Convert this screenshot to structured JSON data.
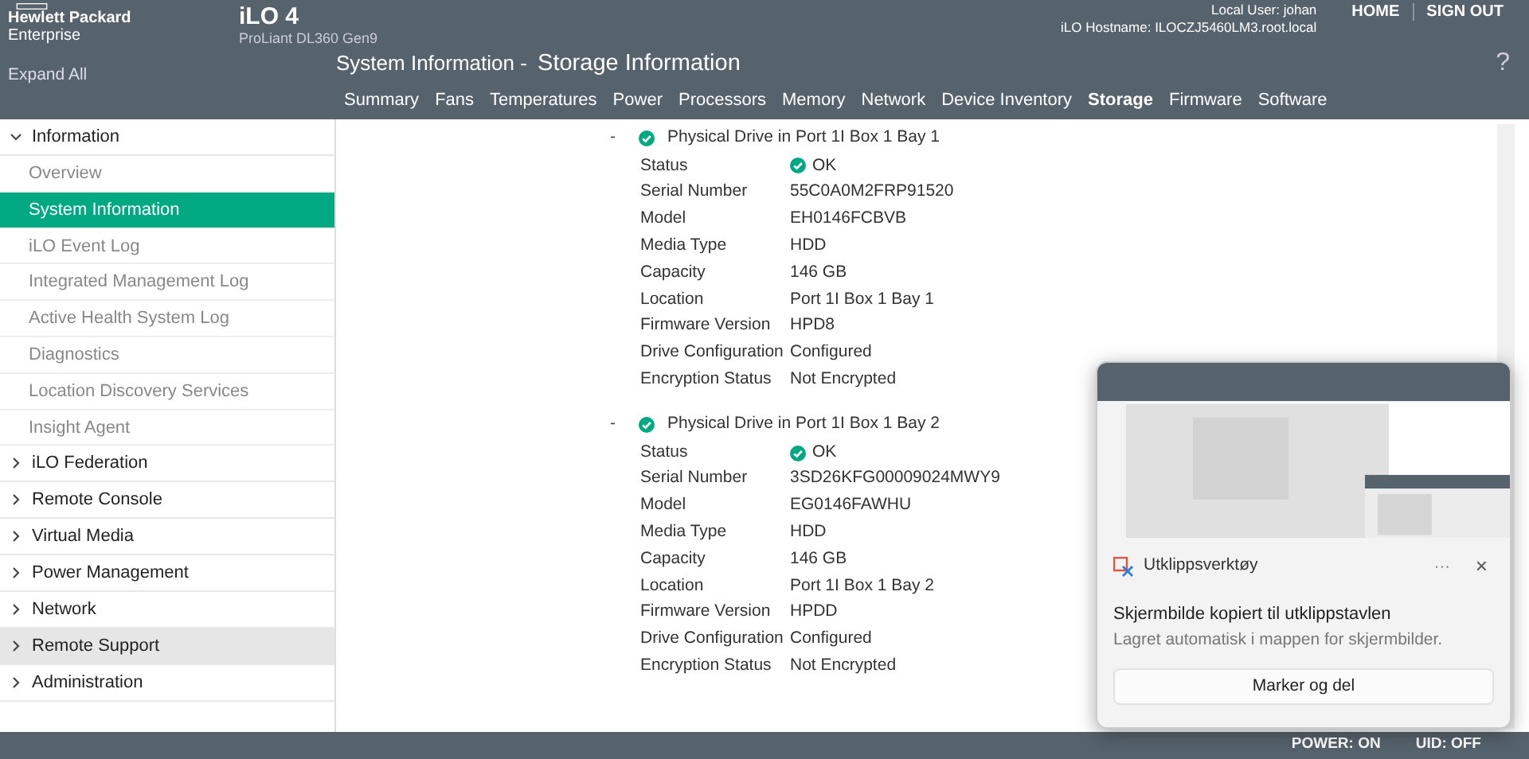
{
  "header": {
    "brand_line_1": "Hewlett Packard",
    "brand_line_2": "Enterprise",
    "product": "iLO 4",
    "server_model": "ProLiant DL360 Gen9",
    "local_user": "Local User: johan",
    "hostname": "iLO Hostname: ILOCZJ5460LM3.root.local",
    "links": [
      "HOME",
      "SIGN OUT"
    ],
    "help": "?"
  },
  "sidebar": {
    "expand_all": "Expand All",
    "items": [
      {
        "label": "Information",
        "expanded": true,
        "hovered": false,
        "children": [
          {
            "label": "Overview",
            "selected": false
          },
          {
            "label": "System Information",
            "selected": true
          },
          {
            "label": "iLO Event Log",
            "selected": false
          },
          {
            "label": "Integrated Management Log",
            "selected": false
          },
          {
            "label": "Active Health System Log",
            "selected": false
          },
          {
            "label": "Diagnostics",
            "selected": false
          },
          {
            "label": "Location Discovery Services",
            "selected": false
          },
          {
            "label": "Insight Agent",
            "selected": false
          }
        ]
      },
      {
        "label": "iLO Federation",
        "expanded": false,
        "hovered": false
      },
      {
        "label": "Remote Console",
        "expanded": false,
        "hovered": false
      },
      {
        "label": "Virtual Media",
        "expanded": false,
        "hovered": false
      },
      {
        "label": "Power Management",
        "expanded": false,
        "hovered": false
      },
      {
        "label": "Network",
        "expanded": false,
        "hovered": false
      },
      {
        "label": "Remote Support",
        "expanded": false,
        "hovered": true
      },
      {
        "label": "Administration",
        "expanded": false,
        "hovered": false
      }
    ]
  },
  "page": {
    "title_prefix": "System Information - ",
    "title": "Storage Information"
  },
  "tabs": [
    {
      "label": "Summary",
      "selected": false
    },
    {
      "label": "Fans",
      "selected": false
    },
    {
      "label": "Temperatures",
      "selected": false
    },
    {
      "label": "Power",
      "selected": false
    },
    {
      "label": "Processors",
      "selected": false
    },
    {
      "label": "Memory",
      "selected": false
    },
    {
      "label": "Network",
      "selected": false
    },
    {
      "label": "Device Inventory",
      "selected": false
    },
    {
      "label": "Storage",
      "selected": true
    },
    {
      "label": "Firmware",
      "selected": false
    },
    {
      "label": "Software",
      "selected": false
    }
  ],
  "drives": [
    {
      "toggle": "-",
      "title": "Physical Drive in Port 1I Box 1 Bay 1",
      "expanded": true,
      "rows": [
        {
          "label": "Status",
          "value": "OK",
          "kind": "status"
        },
        {
          "label": "Serial Number",
          "value": "55C0A0M2FRP91520",
          "kind": "text"
        },
        {
          "label": "Model",
          "value": "EH0146FCBVB",
          "kind": "text"
        },
        {
          "label": "Media Type",
          "value": "HDD",
          "kind": "text"
        },
        {
          "label": "Capacity",
          "value": "146 GB",
          "kind": "text"
        },
        {
          "label": "Location",
          "value": "Port 1I Box 1 Bay 1",
          "kind": "text"
        },
        {
          "label": "Firmware Version",
          "value": "HPD8",
          "kind": "text"
        },
        {
          "label": "Drive Configuration",
          "value": "Configured",
          "kind": "text"
        },
        {
          "label": "Encryption Status",
          "value": "Not Encrypted",
          "kind": "text"
        }
      ]
    },
    {
      "toggle": "-",
      "title": "Physical Drive in Port 1I Box 1 Bay 2",
      "expanded": true,
      "rows": [
        {
          "label": "Status",
          "value": "OK",
          "kind": "status"
        },
        {
          "label": "Serial Number",
          "value": "3SD26KFG00009024MWY9",
          "kind": "text"
        },
        {
          "label": "Model",
          "value": "EG0146FAWHU",
          "kind": "text"
        },
        {
          "label": "Media Type",
          "value": "HDD",
          "kind": "text"
        },
        {
          "label": "Capacity",
          "value": "146 GB",
          "kind": "text"
        },
        {
          "label": "Location",
          "value": "Port 1I Box 1 Bay 2",
          "kind": "text"
        },
        {
          "label": "Firmware Version",
          "value": "HPDD",
          "kind": "text"
        },
        {
          "label": "Drive Configuration",
          "value": "Configured",
          "kind": "text"
        },
        {
          "label": "Encryption Status",
          "value": "Not Encrypted",
          "kind": "text"
        }
      ]
    }
  ],
  "status_bar": {
    "power": "POWER: ON",
    "uid": "UID: OFF"
  },
  "toast": {
    "app": "Utklippsverktøy",
    "more": "···",
    "close": "×",
    "title": "Skjermbilde kopiert til utklippstavlen",
    "message": "Lagret automatisk i mappen for skjermbilder.",
    "button": "Marker og del"
  }
}
